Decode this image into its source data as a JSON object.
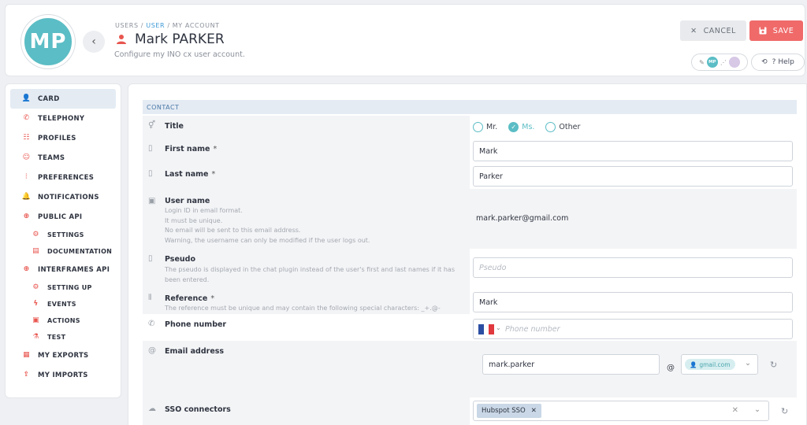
{
  "header": {
    "avatar_initials": "MP",
    "breadcrumb": {
      "part1": "USERS",
      "part2": "USER",
      "part3": "MY ACCOUNT",
      "separator": "/"
    },
    "title": "Mark PARKER",
    "subtitle": "Configure my INO cx user account.",
    "cancel_label": "CANCEL",
    "save_label": "SAVE",
    "presence_initials": "MP",
    "help_label": "Help",
    "help_prefix": "?"
  },
  "sidebar": {
    "items": [
      {
        "label": "CARD",
        "icon": "user-icon",
        "glyph": "👤"
      },
      {
        "label": "TELEPHONY",
        "icon": "phone-icon",
        "glyph": "✆"
      },
      {
        "label": "PROFILES",
        "icon": "profiles-icon",
        "glyph": "☷"
      },
      {
        "label": "TEAMS",
        "icon": "teams-icon",
        "glyph": "☺"
      },
      {
        "label": "PREFERENCES",
        "icon": "sliders-icon",
        "glyph": "⫶"
      },
      {
        "label": "NOTIFICATIONS",
        "icon": "bell-icon",
        "glyph": "🔔"
      },
      {
        "label": "PUBLIC API",
        "icon": "globe-icon",
        "glyph": "⊕"
      },
      {
        "label": "SETTINGS",
        "icon": "gear-icon",
        "glyph": "⚙"
      },
      {
        "label": "DOCUMENTATION",
        "icon": "document-icon",
        "glyph": "▤"
      },
      {
        "label": "INTERFRAMES API",
        "icon": "globe-icon",
        "glyph": "⊕"
      },
      {
        "label": "SETTING UP",
        "icon": "gear-icon",
        "glyph": "⚙"
      },
      {
        "label": "EVENTS",
        "icon": "bolt-icon",
        "glyph": "ϟ"
      },
      {
        "label": "ACTIONS",
        "icon": "monitor-icon",
        "glyph": "▣"
      },
      {
        "label": "TEST",
        "icon": "flask-icon",
        "glyph": "⚗"
      },
      {
        "label": "MY EXPORTS",
        "icon": "table-icon",
        "glyph": "▦"
      },
      {
        "label": "MY IMPORTS",
        "icon": "upload-icon",
        "glyph": "⇪"
      }
    ]
  },
  "contact": {
    "section_title": "CONTACT",
    "title_label": "Title",
    "title_options": [
      "Mr.",
      "Ms.",
      "Other"
    ],
    "title_selected": "Ms.",
    "first_name_label": "First name",
    "first_name_value": "Mark",
    "last_name_label": "Last name",
    "last_name_value": "Parker",
    "required_mark": "*",
    "username_label": "User name",
    "username_help": [
      "Login ID in email format.",
      "It must be unique.",
      "No email will be sent to this email address.",
      "Warning, the username can only be modified if the user logs out."
    ],
    "username_value": "mark.parker@gmail.com",
    "pseudo_label": "Pseudo",
    "pseudo_help": "The pseudo is displayed in the chat plugin instead of the user's first and last names if it has been entered.",
    "pseudo_placeholder": "Pseudo",
    "reference_label": "Reference",
    "reference_help": "The reference must be unique and may contain the following special characters: _+.@-",
    "reference_value": "Mark",
    "phone_label": "Phone number",
    "phone_placeholder": "Phone number",
    "email_label": "Email address",
    "email_local_value": "mark.parker",
    "email_at": "@",
    "email_domain": "gmail.com",
    "sso_label": "SSO connectors",
    "sso_chip": "Hubspot SSO"
  },
  "colors": {
    "accent": "#5bbdc5",
    "save": "#f06a6a",
    "icon_red": "#e8564f",
    "section_bg": "#e4ebf3"
  }
}
